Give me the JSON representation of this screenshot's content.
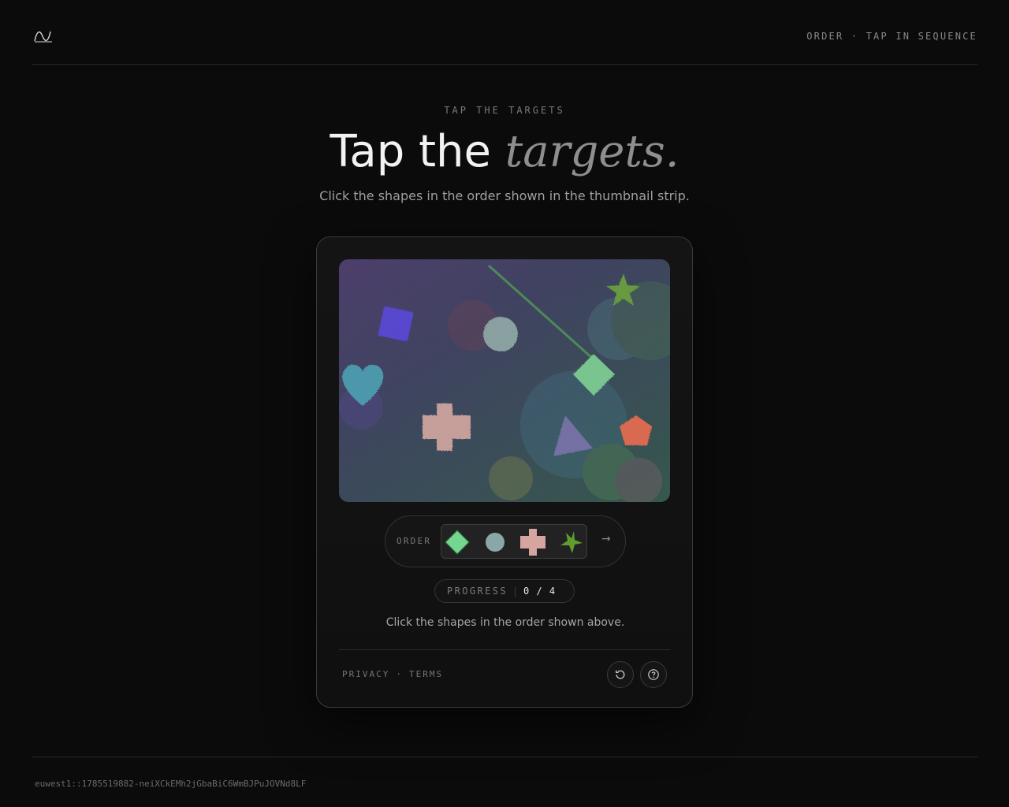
{
  "header": {
    "logo_icon": "wave-logo-icon",
    "tag": "ORDER · TAP IN SEQUENCE"
  },
  "hero": {
    "eyebrow": "TAP THE TARGETS",
    "title_plain": "Tap the ",
    "title_accent": "targets.",
    "subtitle": "Click the shapes in the order shown in the thumbnail strip."
  },
  "challenge": {
    "canvas_shapes": [
      {
        "name": "purple-square-shape",
        "kind": "square",
        "color": "#4a35e0"
      },
      {
        "name": "gray-circle-shape",
        "kind": "circle",
        "color": "#8aa7a8"
      },
      {
        "name": "green-star-shape",
        "kind": "star",
        "color": "#5f9e2e"
      },
      {
        "name": "teal-heart-shape",
        "kind": "heart",
        "color": "#3a9cb5"
      },
      {
        "name": "mint-diamond-shape",
        "kind": "diamond",
        "color": "#74d690"
      },
      {
        "name": "pink-cross-shape",
        "kind": "cross",
        "color": "#d7a5a0"
      },
      {
        "name": "violet-triangle-shape",
        "kind": "triangle",
        "color": "#7d6fb8"
      },
      {
        "name": "red-pentagon-shape",
        "kind": "pentagon",
        "color": "#f06040"
      }
    ],
    "order_label": "ORDER",
    "order_thumbs": [
      {
        "name": "thumb-diamond",
        "kind": "diamond",
        "color": "#74d690"
      },
      {
        "name": "thumb-circle",
        "kind": "circle",
        "color": "#8aa7a8"
      },
      {
        "name": "thumb-cross",
        "kind": "cross",
        "color": "#d7a5a0"
      },
      {
        "name": "thumb-star",
        "kind": "star",
        "color": "#5f9e2e"
      }
    ],
    "arrow": "→",
    "progress_label": "PROGRESS",
    "progress_value": "0 / 4",
    "progress_done": 0,
    "progress_total": 4,
    "hint": "Click the shapes in the order shown above."
  },
  "footer": {
    "privacy": "PRIVACY",
    "separator": "·",
    "terms": "TERMS",
    "refresh_icon": "refresh-icon",
    "help_icon": "help-icon"
  },
  "session_id": "euwest1::1785519882-neiXCkEMh2jGbaBiC6WmBJPuJOVNd8LF"
}
